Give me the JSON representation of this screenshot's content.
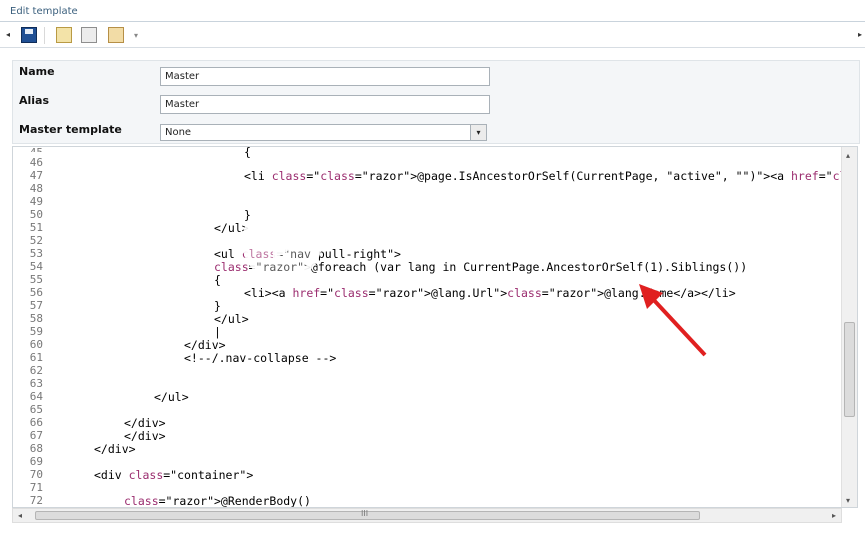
{
  "window": {
    "title": "Edit template"
  },
  "toolbar": {
    "nav_left": "◂",
    "nav_right": "▸",
    "dropdown_glyph": "▾",
    "icons": [
      "save-icon",
      "insert-field-icon",
      "insert-macro-icon",
      "insert-image-icon"
    ]
  },
  "form": {
    "name_label": "Name",
    "name_value": "Master",
    "alias_label": "Alias",
    "alias_value": "Master",
    "master_label": "Master template",
    "master_value": "None",
    "master_dropdown_glyph": "▾"
  },
  "editor": {
    "partial_top_line": "{",
    "lines": [
      {
        "n": "46",
        "t": ""
      },
      {
        "n": "47",
        "t": "<li class=\"@page.IsAncestorOrSelf(CurrentPage, \"active\", \"\")\"><a href=\"@page.Url\">"
      },
      {
        "n": "48",
        "t": ""
      },
      {
        "n": "49",
        "t": ""
      },
      {
        "n": "50",
        "t": "}"
      },
      {
        "n": "51",
        "t": "</ul>"
      },
      {
        "n": "52",
        "t": ""
      },
      {
        "n": "53",
        "t": "<ul class=\"nav pull-right\">"
      },
      {
        "n": "54",
        "t": "@foreach (var lang in CurrentPage.AncestorOrSelf(1).Siblings())"
      },
      {
        "n": "55",
        "t": "{"
      },
      {
        "n": "56",
        "t": "<li><a href=\"@lang.Url\">@lang.Name</a></li>"
      },
      {
        "n": "57",
        "t": "}"
      },
      {
        "n": "58",
        "t": "</ul>"
      },
      {
        "n": "59",
        "t": "|"
      },
      {
        "n": "60",
        "t": "</div>"
      },
      {
        "n": "61",
        "t": "<!--/.nav-collapse -->"
      },
      {
        "n": "62",
        "t": ""
      },
      {
        "n": "63",
        "t": ""
      },
      {
        "n": "64",
        "t": "</ul>"
      },
      {
        "n": "65",
        "t": ""
      },
      {
        "n": "66",
        "t": "</div>"
      },
      {
        "n": "67",
        "t": "</div>"
      },
      {
        "n": "68",
        "t": "</div>"
      },
      {
        "n": "69",
        "t": ""
      },
      {
        "n": "70",
        "t": "<div class=\"container\">"
      },
      {
        "n": "71",
        "t": ""
      },
      {
        "n": "72",
        "t": "@RenderBody()"
      }
    ]
  },
  "scrollbars": {
    "up": "▴",
    "down": "▾",
    "left": "◂",
    "right": "▸",
    "grip": "III"
  },
  "colors": {
    "title_text": "#3a5f7d",
    "razor_highlight": "#fff200",
    "attr_color": "#9b2d6f",
    "arrow_red": "#e02020"
  }
}
